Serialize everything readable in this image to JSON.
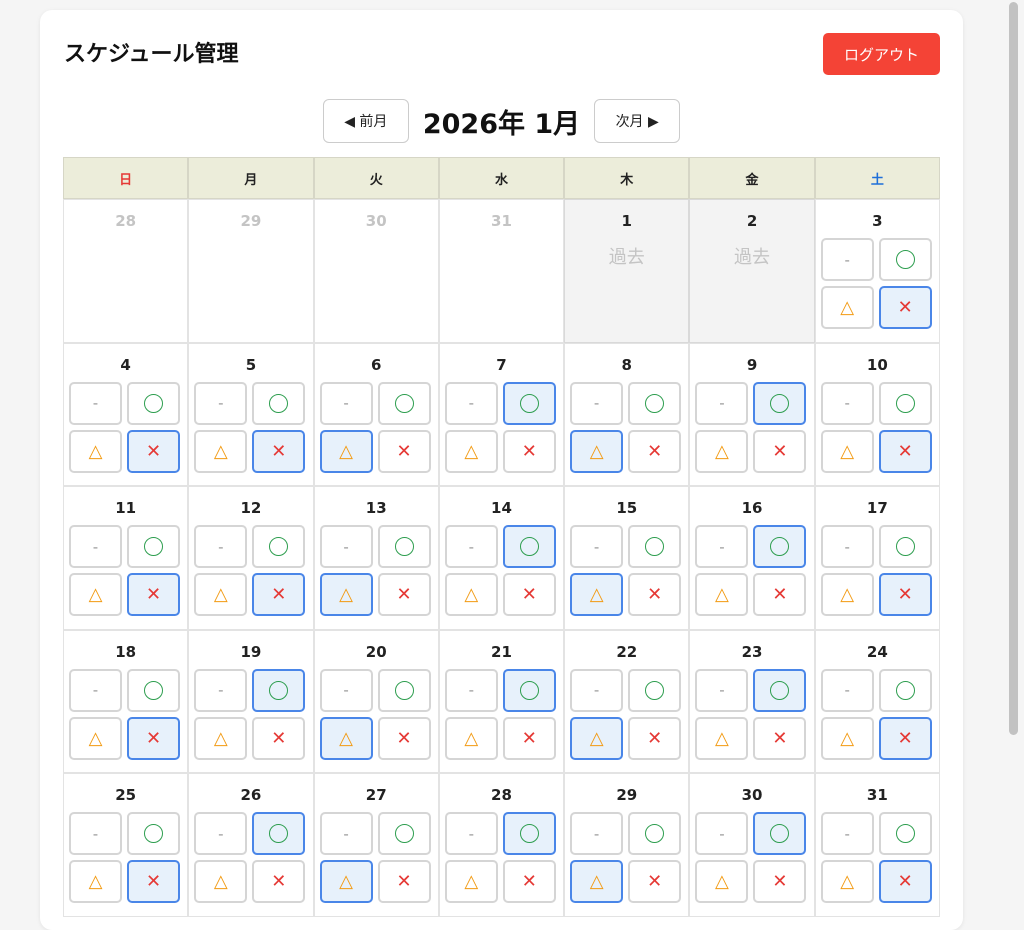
{
  "header": {
    "title": "スケジュール管理",
    "logout_label": "ログアウト"
  },
  "nav": {
    "prev_label": "◀ 前月",
    "next_label": "次月 ▶",
    "month_label": "2026年 1月"
  },
  "weekdays": [
    "日",
    "月",
    "火",
    "水",
    "木",
    "金",
    "土"
  ],
  "options": {
    "none": "-",
    "yes": "◯",
    "maybe": "△",
    "no": "✕"
  },
  "past_label": "過去",
  "days": [
    {
      "d": "28",
      "state": "other"
    },
    {
      "d": "29",
      "state": "other"
    },
    {
      "d": "30",
      "state": "other"
    },
    {
      "d": "31",
      "state": "other"
    },
    {
      "d": "1",
      "state": "past"
    },
    {
      "d": "2",
      "state": "past"
    },
    {
      "d": "3",
      "sel": "no"
    },
    {
      "d": "4",
      "sel": "no"
    },
    {
      "d": "5",
      "sel": "no"
    },
    {
      "d": "6",
      "sel": "maybe"
    },
    {
      "d": "7",
      "sel": "yes"
    },
    {
      "d": "8",
      "sel": "maybe"
    },
    {
      "d": "9",
      "sel": "yes"
    },
    {
      "d": "10",
      "sel": "no"
    },
    {
      "d": "11",
      "sel": "no"
    },
    {
      "d": "12",
      "sel": "no"
    },
    {
      "d": "13",
      "sel": "maybe"
    },
    {
      "d": "14",
      "sel": "yes"
    },
    {
      "d": "15",
      "sel": "maybe"
    },
    {
      "d": "16",
      "sel": "yes"
    },
    {
      "d": "17",
      "sel": "no"
    },
    {
      "d": "18",
      "sel": "no"
    },
    {
      "d": "19",
      "sel": "yes"
    },
    {
      "d": "20",
      "sel": "maybe"
    },
    {
      "d": "21",
      "sel": "yes"
    },
    {
      "d": "22",
      "sel": "maybe"
    },
    {
      "d": "23",
      "sel": "yes"
    },
    {
      "d": "24",
      "sel": "no"
    },
    {
      "d": "25",
      "sel": "no"
    },
    {
      "d": "26",
      "sel": "yes"
    },
    {
      "d": "27",
      "sel": "maybe"
    },
    {
      "d": "28",
      "sel": "yes"
    },
    {
      "d": "29",
      "sel": "maybe"
    },
    {
      "d": "30",
      "sel": "yes"
    },
    {
      "d": "31",
      "sel": "no"
    }
  ],
  "colors": {
    "accent": "#4a86e8",
    "logout": "#f44336",
    "header_bg": "#ecedda"
  }
}
